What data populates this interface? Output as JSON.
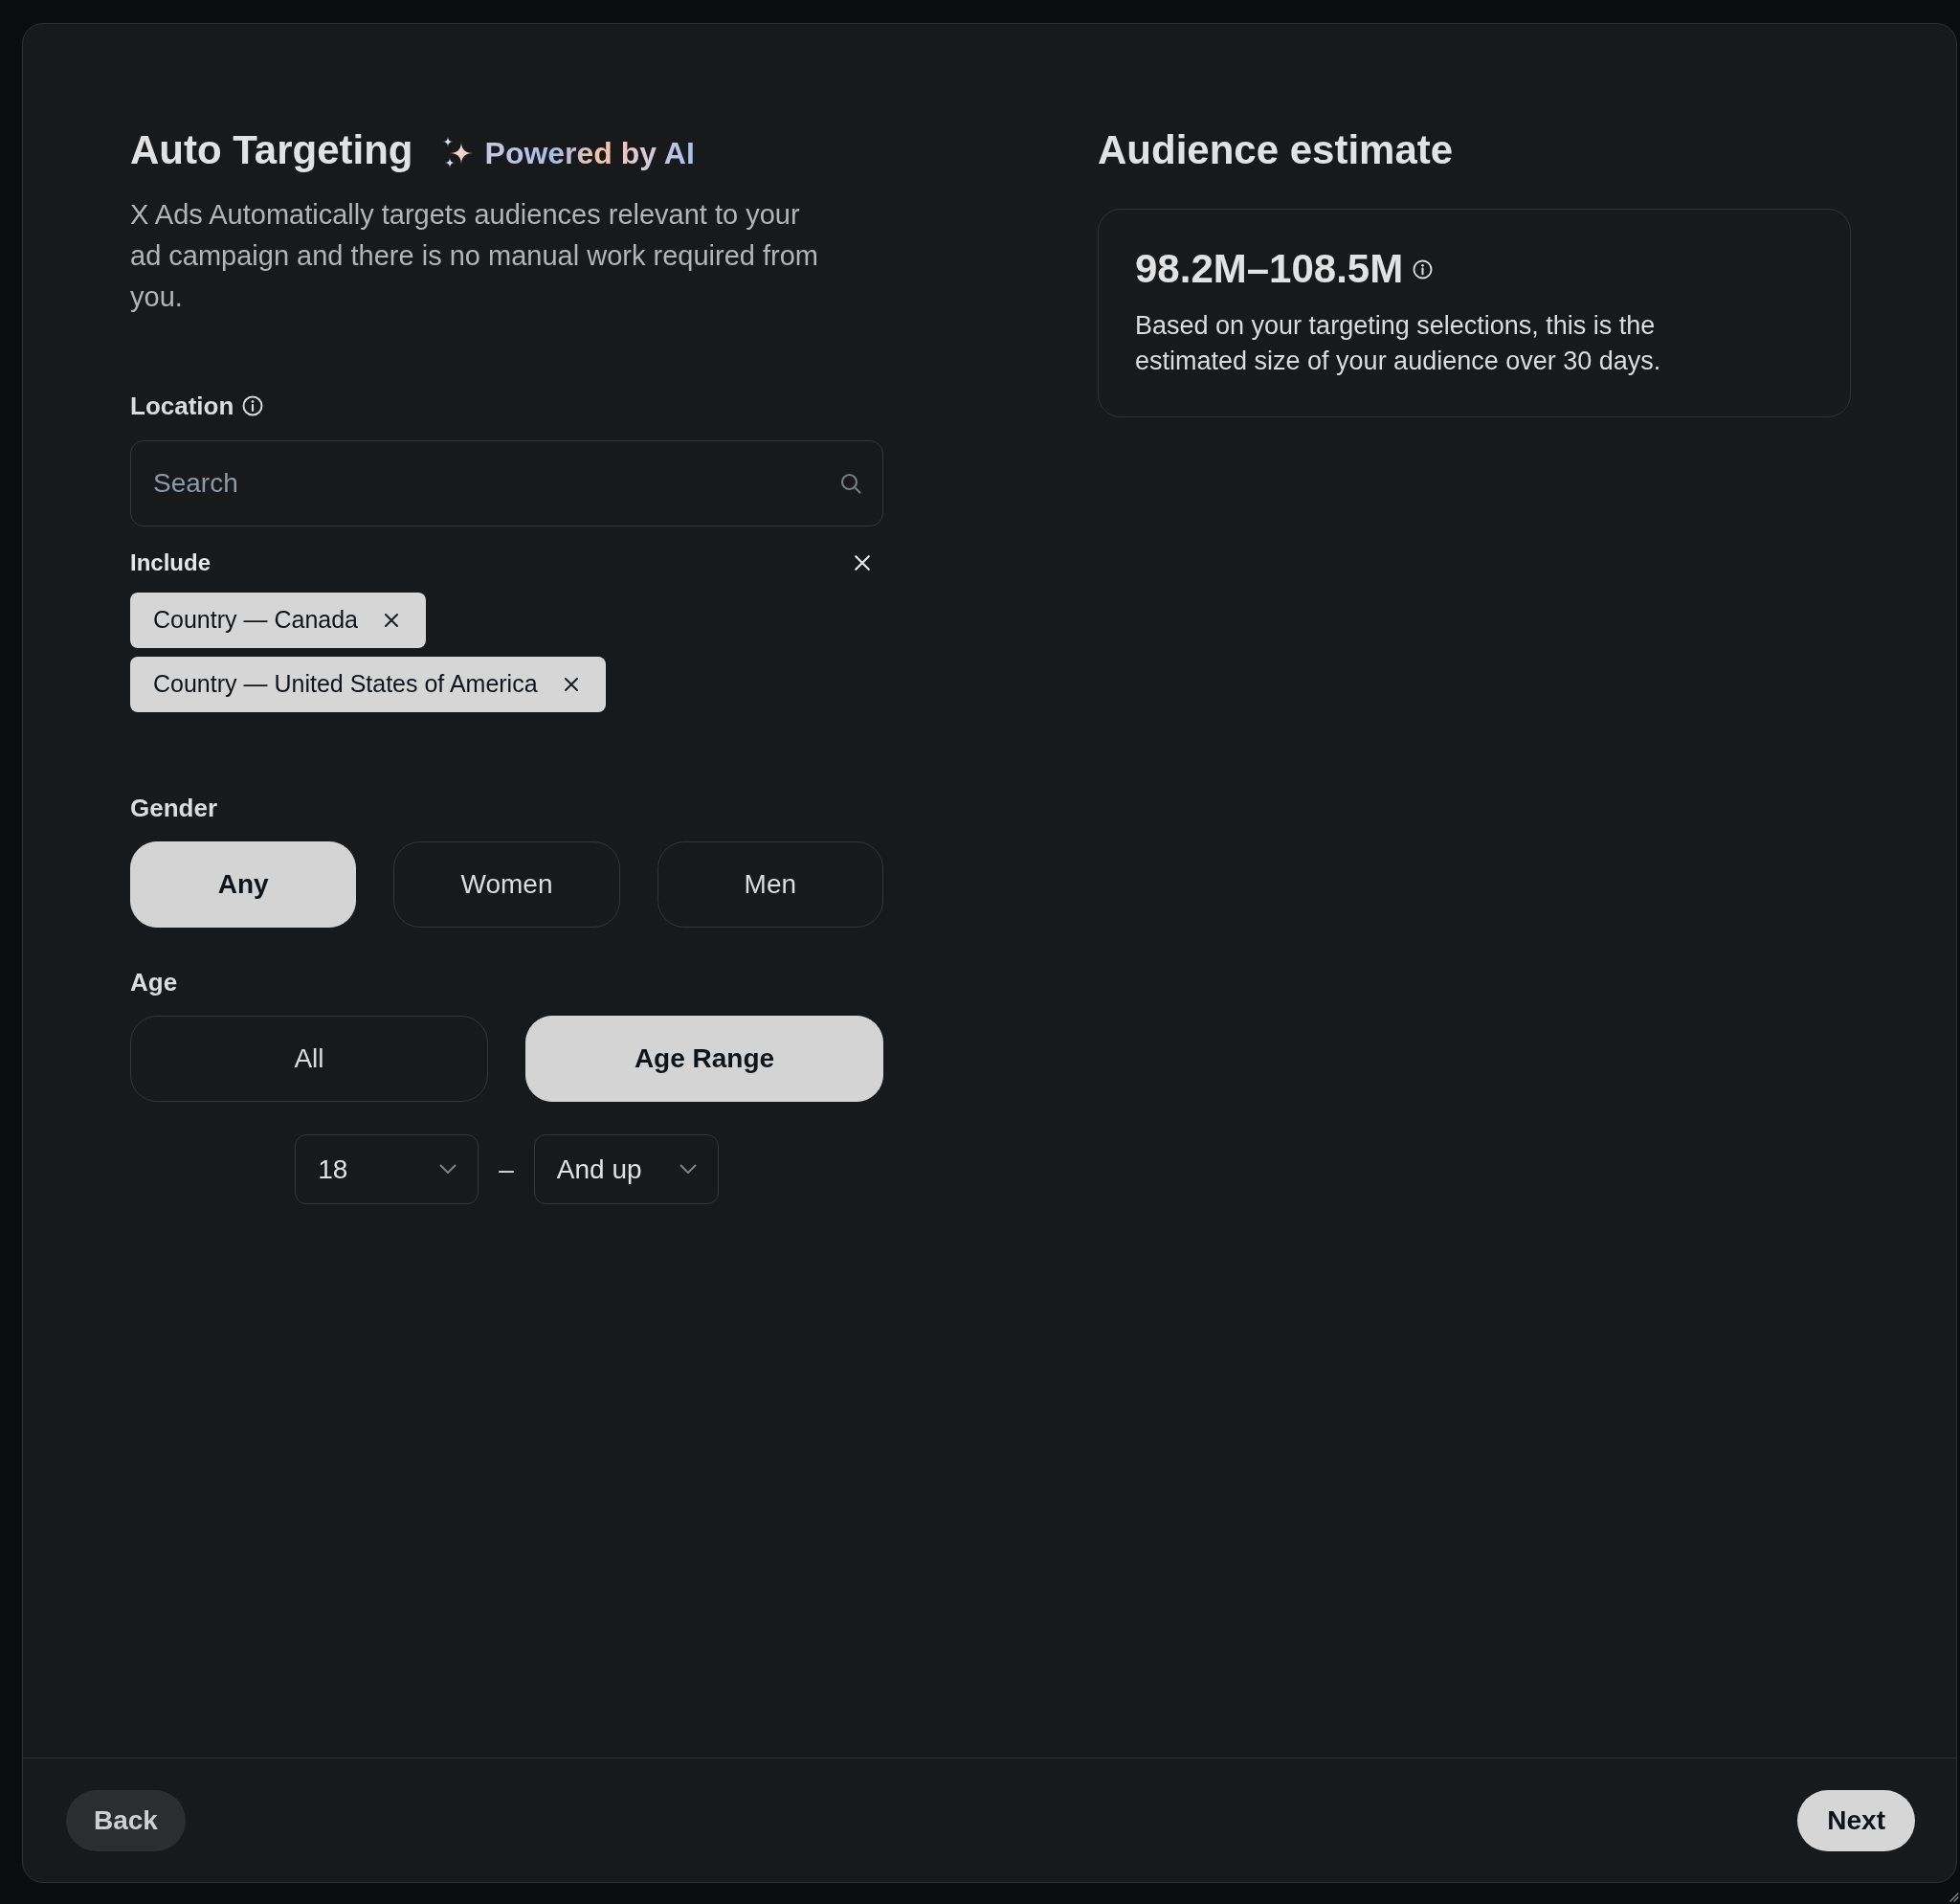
{
  "header": {
    "title": "Auto Targeting",
    "badge": "Powered by AI",
    "description": "X Ads Automatically targets audiences relevant to your ad campaign and there is no manual work required from you."
  },
  "location": {
    "label": "Location",
    "search": {
      "placeholder": "Search"
    },
    "include_label": "Include",
    "chips": [
      {
        "label": "Country — Canada"
      },
      {
        "label": "Country — United States of America"
      }
    ]
  },
  "gender": {
    "label": "Gender",
    "options": [
      {
        "label": "Any",
        "selected": true
      },
      {
        "label": "Women",
        "selected": false
      },
      {
        "label": "Men",
        "selected": false
      }
    ]
  },
  "age": {
    "label": "Age",
    "options": [
      {
        "label": "All",
        "selected": false
      },
      {
        "label": "Age Range",
        "selected": true
      }
    ],
    "range": {
      "from": "18",
      "separator": "–",
      "to": "And up"
    }
  },
  "audience_estimate": {
    "title": "Audience estimate",
    "value": "98.2M–108.5M",
    "description": "Based on your targeting selections, this is the estimated size of your audience over 30 days."
  },
  "footer": {
    "buttons": [
      {
        "label": "Back",
        "kind": "secondary"
      },
      {
        "label": "Next",
        "kind": "primary"
      }
    ]
  }
}
